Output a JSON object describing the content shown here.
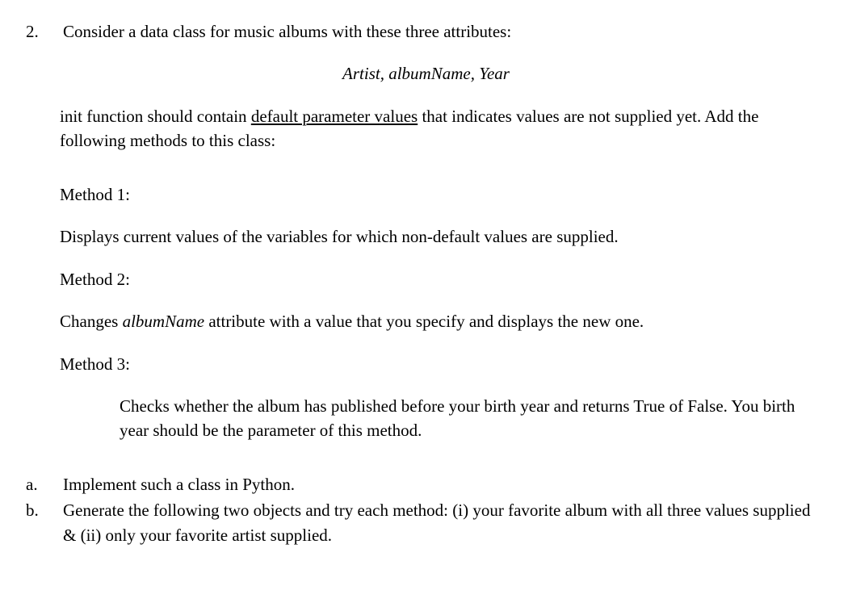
{
  "question": {
    "number": "2.",
    "prompt": "Consider a data class for music albums with these three attributes:",
    "attributes_line": "Artist, albumName, Year",
    "init_line_pre": "init function should contain ",
    "init_line_underlined": "default parameter values",
    "init_line_post": " that indicates values are not supplied yet. Add the following methods to this class:",
    "methods": [
      {
        "label": "Method 1:",
        "text_pre": "Displays current values of the variables for which non-default values are supplied.",
        "italic": "",
        "text_post": ""
      },
      {
        "label": "Method 2:",
        "text_pre": "Changes ",
        "italic": "albumName",
        "text_post": " attribute with a value that you specify and displays the new one."
      },
      {
        "label": "Method 3:",
        "text_pre": "Checks whether the album has published before your birth year and returns  True of False. You birth year should be the parameter of this method.",
        "italic": "",
        "text_post": ""
      }
    ],
    "subparts": [
      {
        "marker": "a.",
        "text": "Implement such a class in Python."
      },
      {
        "marker": "b.",
        "text": "Generate the following two objects and try each method: (i) your favorite album with all three values supplied & (ii) only your favorite artist supplied."
      }
    ]
  }
}
